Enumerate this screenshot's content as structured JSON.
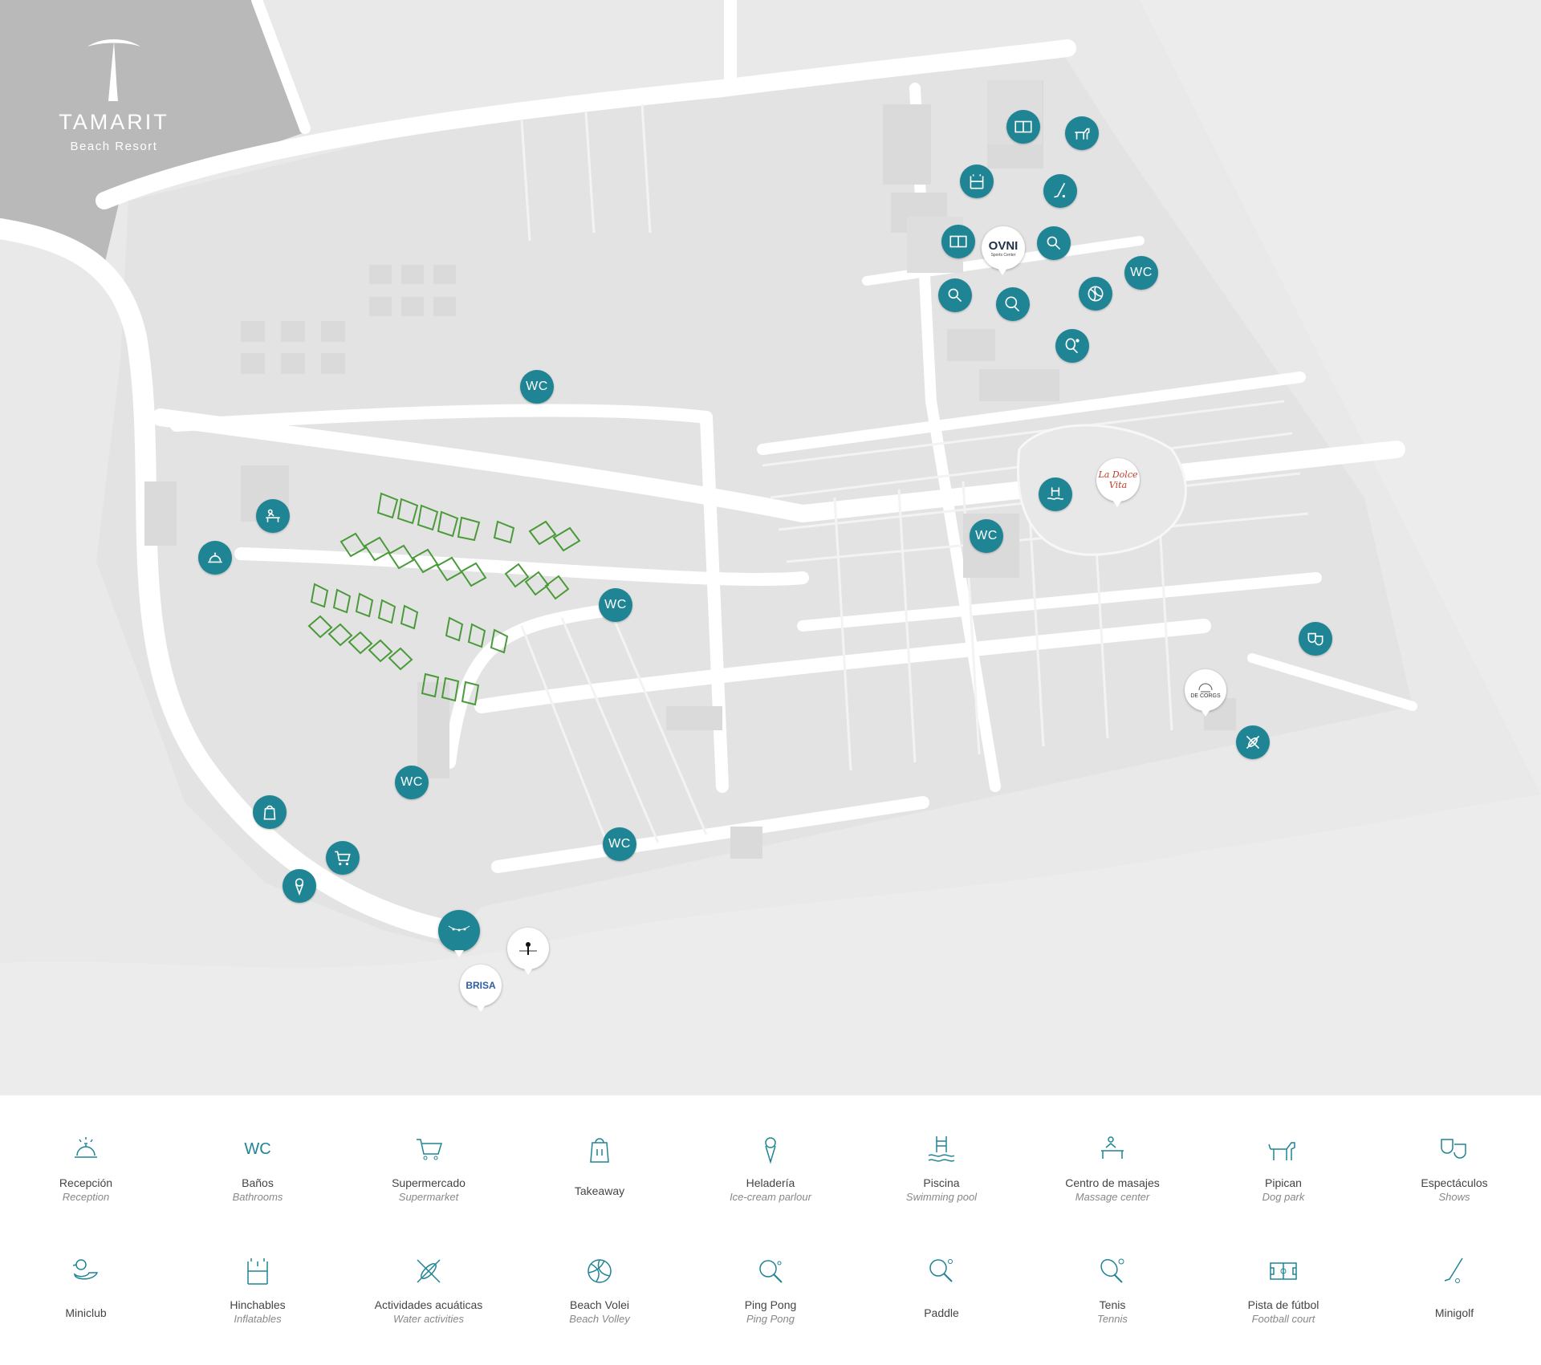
{
  "brand": {
    "name": "TAMARIT",
    "sub": "Beach Resort"
  },
  "map": {
    "wc_label": "WC",
    "places": {
      "ovni": {
        "name": "OVNI",
        "sub": "Sports Center"
      },
      "dolce": {
        "name": "La Dolce Vita"
      },
      "brisa": {
        "name": "BRISA"
      },
      "beach": {
        "name": "DE CORGS"
      }
    }
  },
  "legend": {
    "row1": [
      {
        "icon": "reception-bell",
        "es": "Recepción",
        "en": "Reception"
      },
      {
        "icon": "wc",
        "es": "Baños",
        "en": "Bathrooms"
      },
      {
        "icon": "cart",
        "es": "Supermercado",
        "en": "Supermarket"
      },
      {
        "icon": "takeaway-bag",
        "es": "Takeaway",
        "en": ""
      },
      {
        "icon": "ice-cream",
        "es": "Heladería",
        "en": "Ice-cream parlour"
      },
      {
        "icon": "pool",
        "es": "Piscina",
        "en": "Swimming pool"
      },
      {
        "icon": "massage",
        "es": "Centro de masajes",
        "en": "Massage center"
      },
      {
        "icon": "dog",
        "es": "Pipican",
        "en": "Dog park"
      },
      {
        "icon": "masks",
        "es": "Espectáculos",
        "en": "Shows"
      }
    ],
    "row2": [
      {
        "icon": "duck",
        "es": "Miniclub",
        "en": ""
      },
      {
        "icon": "inflatable",
        "es": "Hinchables",
        "en": "Inflatables"
      },
      {
        "icon": "kayak",
        "es": "Actividades acuáticas",
        "en": "Water activities"
      },
      {
        "icon": "volleyball",
        "es": "Beach Volei",
        "en": "Beach Volley"
      },
      {
        "icon": "pingpong",
        "es": "Ping Pong",
        "en": "Ping Pong"
      },
      {
        "icon": "paddle",
        "es": "Paddle",
        "en": ""
      },
      {
        "icon": "tennis",
        "es": "Tenis",
        "en": "Tennis"
      },
      {
        "icon": "football",
        "es": "Pista de fútbol",
        "en": "Football court"
      },
      {
        "icon": "minigolf",
        "es": "Minigolf",
        "en": ""
      }
    ]
  },
  "colors": {
    "accent": "#1f8494",
    "map_bg": "#e9e9e9",
    "roads": "#ffffff",
    "logo_block": "#b7b7b7",
    "plots": "#4a9a3a"
  }
}
